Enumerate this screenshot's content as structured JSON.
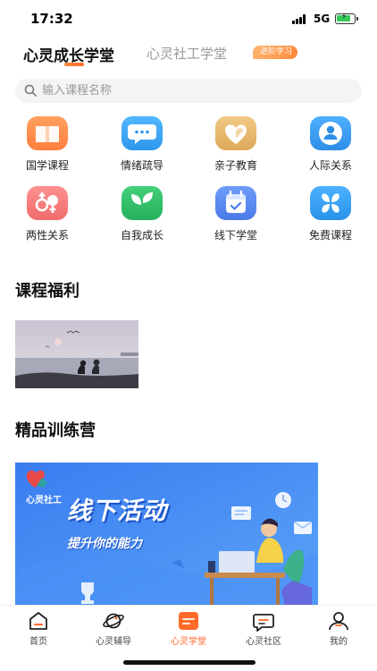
{
  "status_bar": {
    "time": "17:32",
    "network": "5G"
  },
  "header": {
    "active_tab": "心灵成长学堂",
    "inactive_tab": "心灵社工学堂",
    "badge": "进阶学习"
  },
  "search": {
    "placeholder": "输入课程名称",
    "icon": "search-icon"
  },
  "categories": [
    {
      "label": "国学课程",
      "icon": "book-icon",
      "color": "#ff8f4f"
    },
    {
      "label": "情绪疏导",
      "icon": "chat-bubble-icon",
      "color": "#3ea8f5"
    },
    {
      "label": "亲子教育",
      "icon": "heart-icon",
      "color": "#e7b86e"
    },
    {
      "label": "人际关系",
      "icon": "person-icon",
      "color": "#3c9cf0"
    },
    {
      "label": "两性关系",
      "icon": "gender-icon",
      "color": "#f47a7a"
    },
    {
      "label": "自我成长",
      "icon": "leaf-icon",
      "color": "#35c06b"
    },
    {
      "label": "线下学堂",
      "icon": "calendar-icon",
      "color": "#5a8cf2"
    },
    {
      "label": "免费课程",
      "icon": "clover-icon",
      "color": "#3aa3f2"
    }
  ],
  "sections": {
    "welfare_title": "课程福利",
    "camp_title": "精品训练营"
  },
  "banner": {
    "logo_text": "心灵社工",
    "title": "线下活动",
    "subtitle": "提升你的能力"
  },
  "tabbar": [
    {
      "label": "首页",
      "icon": "home-icon",
      "active": false
    },
    {
      "label": "心灵辅导",
      "icon": "planet-icon",
      "active": false
    },
    {
      "label": "心灵学堂",
      "icon": "school-icon",
      "active": true
    },
    {
      "label": "心灵社区",
      "icon": "community-icon",
      "active": false
    },
    {
      "label": "我的",
      "icon": "profile-icon",
      "active": false
    }
  ],
  "colors": {
    "accent": "#ff6a2a",
    "banner_blue": "#3b86f5"
  }
}
